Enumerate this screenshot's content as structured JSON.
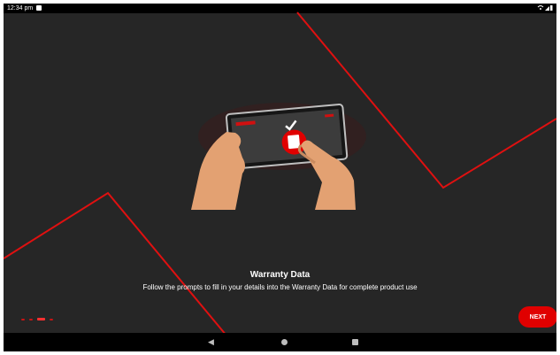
{
  "status_bar": {
    "time": "12:34 pm",
    "notification_icon": "message-notification-icon",
    "right_icons": [
      "wifi-icon",
      "signal-icon",
      "battery-icon"
    ]
  },
  "onboarding": {
    "title": "Warranty Data",
    "description": "Follow the prompts to fill in your details into the Warranty Data for complete product use",
    "page_indicator": {
      "total": 4,
      "current": 3
    },
    "next_label": "NEXT",
    "illustration_icon": "tablet-with-hands-illustration"
  },
  "nav_bar": {
    "back_icon": "back-triangle-icon",
    "home_icon": "home-circle-icon",
    "recent_icon": "recent-apps-square-icon"
  },
  "colors": {
    "accent": "#e00000",
    "background": "#262626",
    "system_bars": "#000000"
  }
}
